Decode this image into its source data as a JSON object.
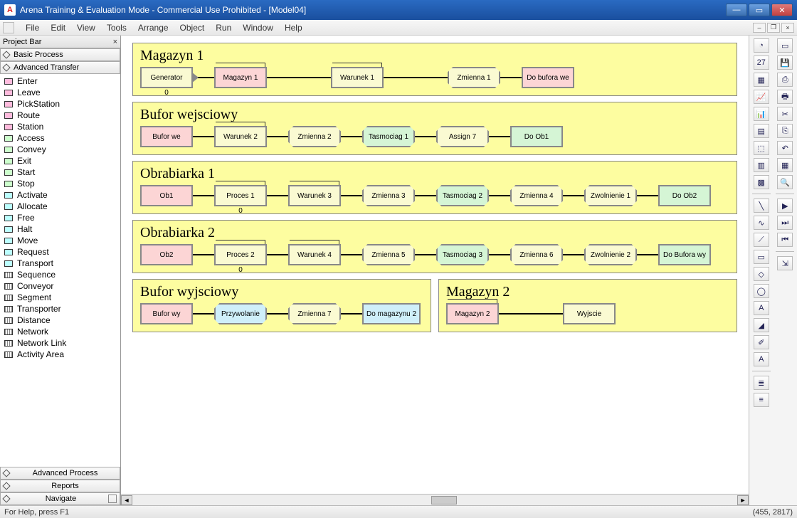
{
  "title": "Arena Training & Evaluation Mode - Commercial Use Prohibited - [Model04]",
  "menu": [
    "File",
    "Edit",
    "View",
    "Tools",
    "Arrange",
    "Object",
    "Run",
    "Window",
    "Help"
  ],
  "projectbar": {
    "header": "Project Bar",
    "sections_top": [
      "Basic Process",
      "Advanced Transfer"
    ],
    "items": [
      {
        "label": "Enter",
        "cls": "pb-pink"
      },
      {
        "label": "Leave",
        "cls": "pb-pink"
      },
      {
        "label": "PickStation",
        "cls": "pb-pink"
      },
      {
        "label": "Route",
        "cls": "pb-pink"
      },
      {
        "label": "Station",
        "cls": "pb-pink"
      },
      {
        "label": "Access",
        "cls": "pb-green"
      },
      {
        "label": "Convey",
        "cls": "pb-green"
      },
      {
        "label": "Exit",
        "cls": "pb-green"
      },
      {
        "label": "Start",
        "cls": "pb-green"
      },
      {
        "label": "Stop",
        "cls": "pb-green"
      },
      {
        "label": "Activate",
        "cls": "pb-cyan"
      },
      {
        "label": "Allocate",
        "cls": "pb-cyan"
      },
      {
        "label": "Free",
        "cls": "pb-cyan"
      },
      {
        "label": "Halt",
        "cls": "pb-cyan"
      },
      {
        "label": "Move",
        "cls": "pb-cyan"
      },
      {
        "label": "Request",
        "cls": "pb-cyan"
      },
      {
        "label": "Transport",
        "cls": "pb-cyan"
      },
      {
        "label": "Sequence",
        "cls": "pb-grid"
      },
      {
        "label": "Conveyor",
        "cls": "pb-grid"
      },
      {
        "label": "Segment",
        "cls": "pb-grid"
      },
      {
        "label": "Transporter",
        "cls": "pb-grid"
      },
      {
        "label": "Distance",
        "cls": "pb-grid"
      },
      {
        "label": "Network",
        "cls": "pb-grid"
      },
      {
        "label": "Network Link",
        "cls": "pb-grid"
      },
      {
        "label": "Activity Area",
        "cls": "pb-grid"
      }
    ],
    "sections_bottom": [
      "Advanced Process",
      "Reports",
      "Navigate"
    ]
  },
  "groups": [
    {
      "title": "Magazyn 1",
      "blocks": [
        {
          "t": "Generator",
          "cls": "yellow",
          "tri": true,
          "count": "0"
        },
        {
          "t": "Magazyn 1",
          "cls": "pink",
          "queue": true
        },
        {
          "t": "Warunek 1",
          "cls": "yellow",
          "queue": true,
          "long": true
        },
        {
          "t": "Zmienna 1",
          "cls": "yellow oct",
          "long": true
        },
        {
          "t": "Do bufora we",
          "cls": "pink"
        }
      ]
    },
    {
      "title": "Bufor wejsciowy",
      "blocks": [
        {
          "t": "Bufor we",
          "cls": "pink"
        },
        {
          "t": "Warunek 2",
          "cls": "yellow",
          "queue": true
        },
        {
          "t": "Zmienna 2",
          "cls": "yellow oct"
        },
        {
          "t": "Tasmociag 1",
          "cls": "green oct",
          "queue": true
        },
        {
          "t": "Assign 7",
          "cls": "yellow oct"
        },
        {
          "t": "Do Ob1",
          "cls": "green"
        }
      ]
    },
    {
      "title": "Obrabiarka 1",
      "blocks": [
        {
          "t": "Ob1",
          "cls": "pink"
        },
        {
          "t": "Proces 1",
          "cls": "yellow",
          "queue": true,
          "count": "0"
        },
        {
          "t": "Warunek 3",
          "cls": "yellow",
          "queue": true
        },
        {
          "t": "Zmienna 3",
          "cls": "yellow oct"
        },
        {
          "t": "Tasmociag 2",
          "cls": "green oct",
          "queue": true
        },
        {
          "t": "Zmienna 4",
          "cls": "yellow oct"
        },
        {
          "t": "Zwolnienie 1",
          "cls": "yellow oct"
        },
        {
          "t": "Do Ob2",
          "cls": "green"
        }
      ]
    },
    {
      "title": "Obrabiarka 2",
      "blocks": [
        {
          "t": "Ob2",
          "cls": "pink"
        },
        {
          "t": "Proces 2",
          "cls": "yellow",
          "queue": true,
          "count": "0"
        },
        {
          "t": "Warunek 4",
          "cls": "yellow",
          "queue": true
        },
        {
          "t": "Zmienna 5",
          "cls": "yellow oct"
        },
        {
          "t": "Tasmociag 3",
          "cls": "green oct",
          "queue": true
        },
        {
          "t": "Zmienna 6",
          "cls": "yellow oct"
        },
        {
          "t": "Zwolnienie 2",
          "cls": "yellow oct"
        },
        {
          "t": "Do Bufora wy",
          "cls": "green"
        }
      ]
    }
  ],
  "bottom_groups": {
    "left": {
      "title": "Bufor wyjsciowy",
      "blocks": [
        {
          "t": "Bufor wy",
          "cls": "pink"
        },
        {
          "t": "Przywolanie",
          "cls": "cyan oct",
          "queue": true
        },
        {
          "t": "Zmienna 7",
          "cls": "yellow oct"
        },
        {
          "t": "Do magazynu 2",
          "cls": "cyan"
        }
      ]
    },
    "right": {
      "title": "Magazyn 2",
      "blocks": [
        {
          "t": "Magazyn 2",
          "cls": "pink",
          "queue": true
        },
        {
          "t": "Wyjscie",
          "cls": "yellow",
          "long": true
        }
      ]
    }
  },
  "status": {
    "help": "For Help, press F1",
    "coords": "(455, 2817)"
  }
}
